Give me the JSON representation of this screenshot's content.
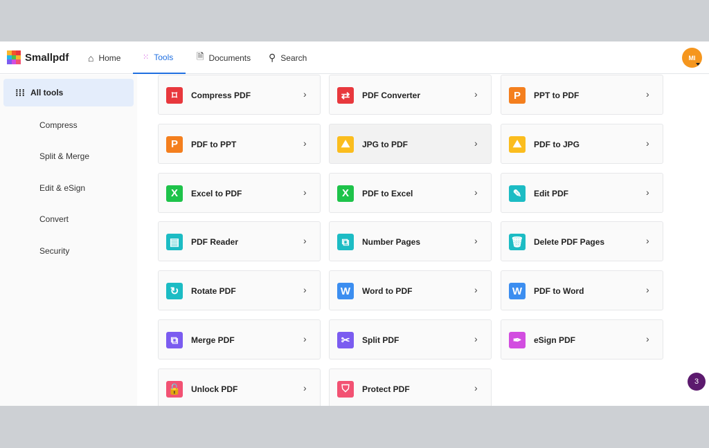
{
  "header": {
    "brand": "Smallpdf",
    "nav": [
      {
        "label": "Home",
        "icon": "home-icon"
      },
      {
        "label": "Tools",
        "icon": "tools-grid-icon",
        "active": true
      },
      {
        "label": "Documents",
        "icon": "document-icon"
      },
      {
        "label": "Search",
        "icon": "search-icon"
      }
    ],
    "avatar_initials": "MI"
  },
  "sidebar": {
    "all_tools": "All tools",
    "items": [
      "Compress",
      "Split & Merge",
      "Edit & eSign",
      "Convert",
      "Security"
    ]
  },
  "tools": [
    {
      "label": "Compress PDF",
      "color": "#e8383d",
      "glyph": "⌑"
    },
    {
      "label": "PDF Converter",
      "color": "#e8383d",
      "glyph": "⇄"
    },
    {
      "label": "PPT to PDF",
      "color": "#f47f1e",
      "glyph": "P"
    },
    {
      "label": "PDF to PPT",
      "color": "#f47f1e",
      "glyph": "P"
    },
    {
      "label": "JPG to PDF",
      "color": "#fbbd1e",
      "glyph": "⛰"
    },
    {
      "label": "PDF to JPG",
      "color": "#fbbd1e",
      "glyph": "⛰"
    },
    {
      "label": "Excel to PDF",
      "color": "#1ec34a",
      "glyph": "X"
    },
    {
      "label": "PDF to Excel",
      "color": "#1ec34a",
      "glyph": "X"
    },
    {
      "label": "Edit PDF",
      "color": "#1cbcc4",
      "glyph": "✎"
    },
    {
      "label": "PDF Reader",
      "color": "#1cbcc4",
      "glyph": "▤"
    },
    {
      "label": "Number Pages",
      "color": "#1cbcc4",
      "glyph": "⧉"
    },
    {
      "label": "Delete PDF Pages",
      "color": "#1cbcc4",
      "glyph": "🗑"
    },
    {
      "label": "Rotate PDF",
      "color": "#1cbcc4",
      "glyph": "↻"
    },
    {
      "label": "Word to PDF",
      "color": "#3c8ef0",
      "glyph": "W"
    },
    {
      "label": "PDF to Word",
      "color": "#3c8ef0",
      "glyph": "W"
    },
    {
      "label": "Merge PDF",
      "color": "#7b5cf0",
      "glyph": "⧉"
    },
    {
      "label": "Split PDF",
      "color": "#7b5cf0",
      "glyph": "✂"
    },
    {
      "label": "eSign PDF",
      "color": "#d24ee0",
      "glyph": "✒"
    },
    {
      "label": "Unlock PDF",
      "color": "#f25273",
      "glyph": "🔓"
    },
    {
      "label": "Protect PDF",
      "color": "#f25273",
      "glyph": "⛉"
    }
  ],
  "hovered_tool": "JPG to PDF",
  "notification_count": "3"
}
